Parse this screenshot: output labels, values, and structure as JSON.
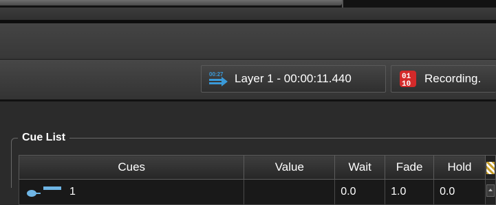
{
  "toolbar": {
    "layer_status": "Layer 1 - 00:00:11.440",
    "layer_icon_text": "00:27",
    "recording_status": "Recording."
  },
  "cue_list": {
    "title": "Cue List",
    "columns": [
      "Cues",
      "Value",
      "Wait",
      "Fade",
      "Hold"
    ],
    "rows": [
      {
        "cue": "1",
        "value": "",
        "wait": "0.0",
        "fade": "1.0",
        "hold": "0.0"
      }
    ]
  },
  "colors": {
    "accent_blue": "#3a9ad9",
    "record_red": "#d42a2a",
    "background": "#2b2b2b"
  },
  "icons": {
    "layer": "clock-arrow-icon",
    "recording": "record-binary-icon",
    "cue": "cue-key-icon",
    "column_settings": "column-settings-icon"
  }
}
